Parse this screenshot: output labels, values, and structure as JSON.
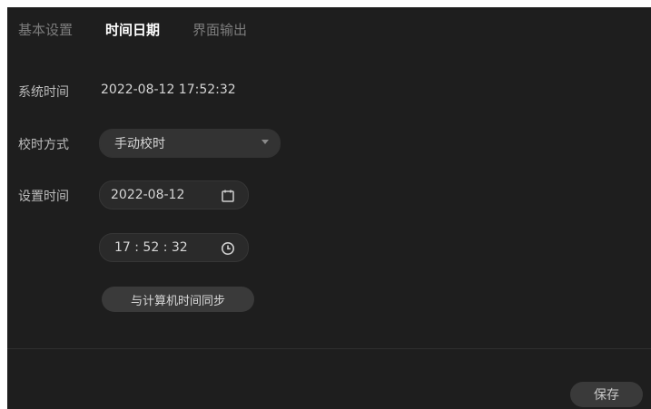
{
  "tabs": [
    {
      "label": "基本设置",
      "active": false
    },
    {
      "label": "时间日期",
      "active": true
    },
    {
      "label": "界面输出",
      "active": false
    }
  ],
  "system_time": {
    "label": "系统时间",
    "value": "2022-08-12 17:52:32"
  },
  "sync_mode": {
    "label": "校时方式",
    "selected": "手动校时"
  },
  "set_time": {
    "label": "设置时间",
    "date_value": "2022-08-12",
    "time_value": "17 : 52 : 32",
    "date_icon": "calendar-icon",
    "time_icon": "clock-icon"
  },
  "sync_button": {
    "label": "与计算机时间同步"
  },
  "save_button": {
    "label": "保存"
  },
  "colors": {
    "background": "#1e1e1e",
    "control": "#333333",
    "active_tab": "#ffffff",
    "inactive_tab": "#7c7c7c"
  }
}
